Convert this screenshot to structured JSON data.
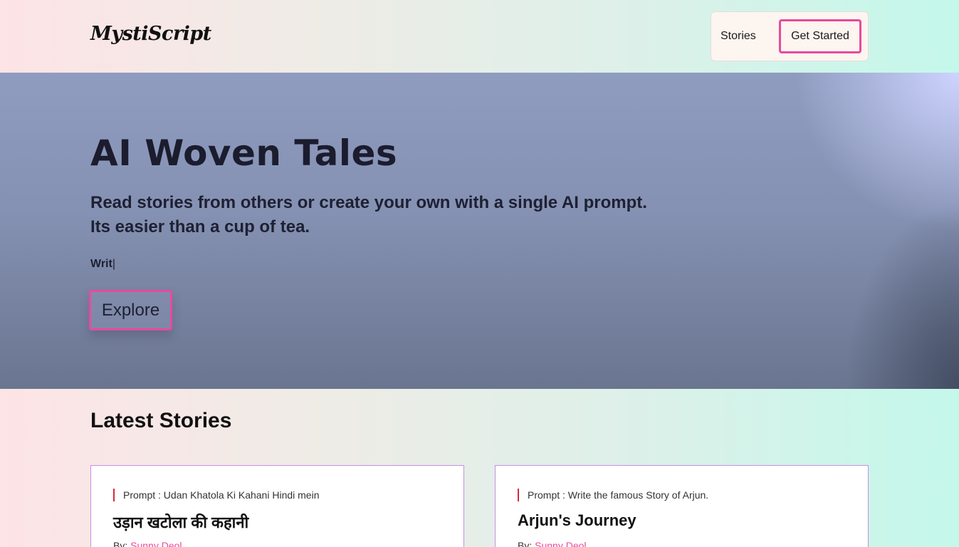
{
  "header": {
    "logo": "MystiScript",
    "nav": {
      "stories_label": "Stories",
      "get_started_label": "Get Started"
    }
  },
  "hero": {
    "title": "AI Woven Tales",
    "subtitle_line1": "Read stories from others or create your own with a single AI prompt.",
    "subtitle_line2": "Its easier than a cup of tea.",
    "typing_text": "Writ",
    "typing_cursor": "|",
    "explore_label": "Explore"
  },
  "latest": {
    "title": "Latest Stories",
    "stories": [
      {
        "prompt": "Prompt : Udan Khatola Ki Kahani Hindi mein",
        "title": "उड़ान खटोला की कहानी",
        "by_label": "By:",
        "author": "Sunny Deol"
      },
      {
        "prompt": "Prompt : Write the famous Story of Arjun.",
        "title": "Arjun's Journey",
        "by_label": "By:",
        "author": "Sunny Deol"
      }
    ]
  },
  "colors": {
    "accent": "#e84a9c",
    "prompt_bar": "#d62b3b",
    "card_border": "#c88ee2"
  }
}
